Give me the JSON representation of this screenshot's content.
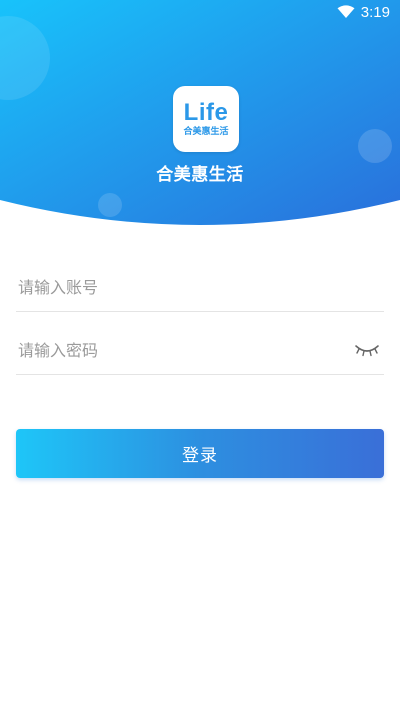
{
  "status_bar": {
    "time": "3:19",
    "wifi_icon": "wifi-icon"
  },
  "brand": {
    "logo_word": "Life",
    "logo_sub": "合美惠生活",
    "app_name": "合美惠生活",
    "colors": {
      "gradient_start": "#18c3fb",
      "gradient_end": "#2a6fdb",
      "accent": "#2b98e8"
    }
  },
  "form": {
    "account_placeholder": "请输入账号",
    "password_placeholder": "请输入密码",
    "password_toggle_icon": "eye-closed-icon",
    "login_label": "登录"
  }
}
